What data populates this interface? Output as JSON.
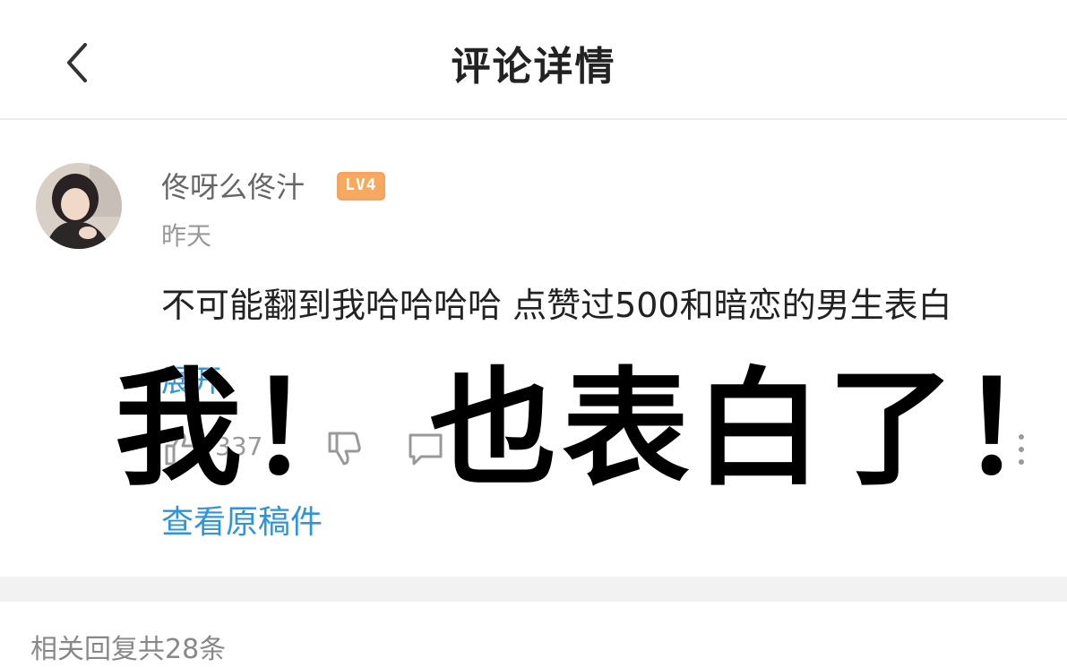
{
  "header": {
    "title": "评论详情",
    "back_icon": "chevron-left-icon"
  },
  "comment": {
    "username": "佟呀么佟汁",
    "level": "LV4",
    "timestamp": "昨天",
    "text": "不可能翻到我哈哈哈哈 点赞过500和暗恋的男生表白",
    "expand_label": "展开",
    "like_count": "337",
    "view_original_label": "查看原稿件"
  },
  "replies": {
    "count_label": "相关回复共28条"
  },
  "overlay": {
    "caption": "我！ 也表白了！"
  },
  "colors": {
    "link": "#2f95d6",
    "level_badge": "#f7a95f",
    "divider_band": "#f2f2f2"
  }
}
